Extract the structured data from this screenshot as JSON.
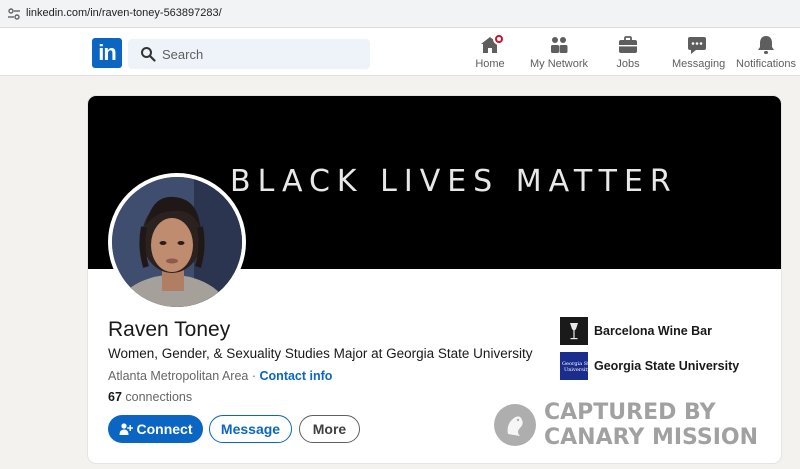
{
  "browser": {
    "url": "linkedin.com/in/raven-toney-563897283/"
  },
  "nav": {
    "logo": "in",
    "search_placeholder": "Search",
    "items": [
      {
        "label": "Home",
        "icon": "home-icon"
      },
      {
        "label": "My Network",
        "icon": "network-icon"
      },
      {
        "label": "Jobs",
        "icon": "briefcase-icon"
      },
      {
        "label": "Messaging",
        "icon": "chat-icon"
      },
      {
        "label": "Notifications",
        "icon": "bell-icon"
      }
    ]
  },
  "profile": {
    "banner_text": "BLACK LIVES MATTER",
    "name": "Raven Toney",
    "headline": "Women, Gender, & Sexuality Studies Major at Georgia State University",
    "location": "Atlanta Metropolitan Area",
    "location_separator": "·",
    "contact_info": "Contact info",
    "connections_count": "67",
    "connections_label": "connections",
    "buttons": {
      "connect": "Connect",
      "message": "Message",
      "more": "More"
    },
    "orgs": [
      {
        "name": "Barcelona Wine Bar",
        "logo_icon": "barcelona-logo-icon"
      },
      {
        "name": "Georgia State University",
        "logo_icon": "gsu-logo-icon",
        "logo_text": "Georgia State University"
      }
    ]
  },
  "watermark": {
    "line1": "CAPTURED BY",
    "line2": "CANARY MISSION"
  },
  "colors": {
    "brand": "#0a66c2",
    "banner": "#000000",
    "badge": "#cb112d",
    "gsu": "#1a2d8c"
  }
}
